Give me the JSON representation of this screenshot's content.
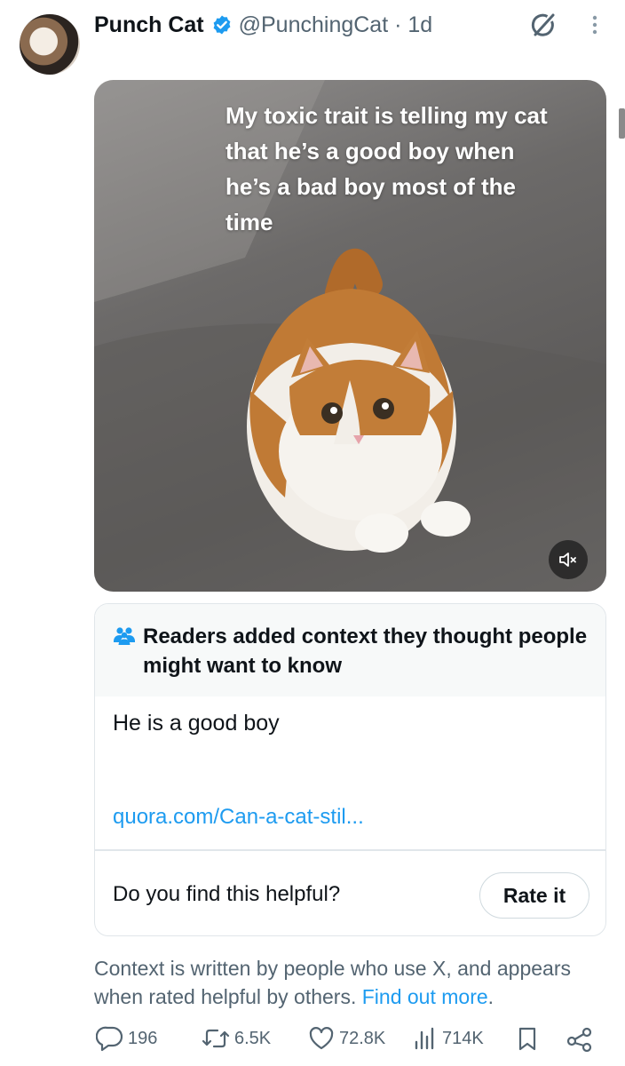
{
  "post": {
    "author_name": "Punch Cat",
    "handle_and_time": "@PunchingCat · 1d",
    "media_caption": "My toxic trait is telling my cat that he’s a good boy when he’s a bad boy most of the time",
    "icons": [
      "verified-badge-icon",
      "grok-icon",
      "more-icon",
      "mute-icon"
    ]
  },
  "community_note": {
    "title": "Readers added context they thought people might want to know",
    "text": "He is a good boy",
    "link": "quora.com/Can-a-cat-stil...",
    "helpful_question": "Do you find this helpful?",
    "rate_label": "Rate it"
  },
  "context_info": {
    "text": "Context is written by people who use X, and appears when rated helpful by others. ",
    "link": "Find out more",
    "period": "."
  },
  "actions": {
    "replies": "196",
    "reposts": "6.5K",
    "likes": "72.8K",
    "views": "714K"
  },
  "colors": {
    "accent": "#1d9bf0",
    "verified": "#1d9bf0",
    "secondary_text": "#536471",
    "border": "#e1e6ea"
  }
}
